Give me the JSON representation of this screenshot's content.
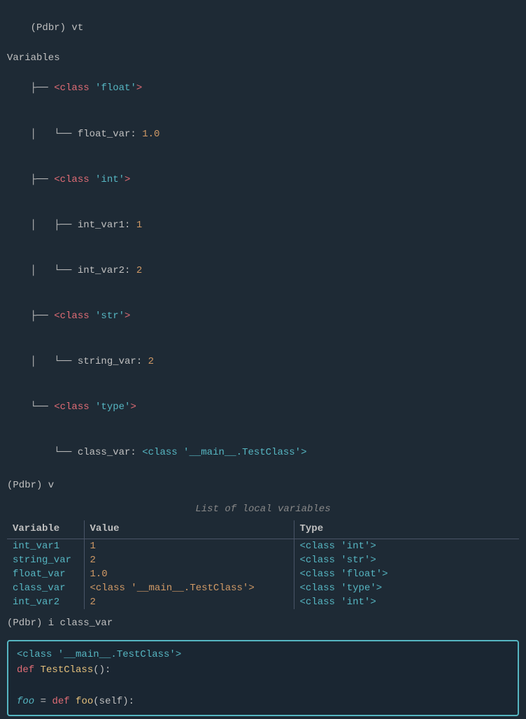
{
  "terminal": {
    "lines": [
      {
        "id": "cmd1",
        "text": "(Pdbr) vt"
      },
      {
        "id": "variables_header",
        "text": "Variables"
      },
      {
        "id": "class_float_line",
        "parts": [
          {
            "text": "├── ",
            "color": "tree"
          },
          {
            "text": "<class ",
            "color": "keyword-red"
          },
          {
            "text": "'float'",
            "color": "teal"
          },
          {
            "text": ">",
            "color": "keyword-red"
          }
        ]
      },
      {
        "id": "float_var_line",
        "parts": [
          {
            "text": "│   └── float_var: ",
            "color": "tree"
          },
          {
            "text": "1.0",
            "color": "orange"
          }
        ]
      },
      {
        "id": "class_int_line",
        "parts": [
          {
            "text": "├── ",
            "color": "tree"
          },
          {
            "text": "<class ",
            "color": "keyword-red"
          },
          {
            "text": "'int'",
            "color": "teal"
          },
          {
            "text": ">",
            "color": "keyword-red"
          }
        ]
      },
      {
        "id": "int_var1_line",
        "parts": [
          {
            "text": "│   ├── int_var1: ",
            "color": "tree"
          },
          {
            "text": "1",
            "color": "orange"
          }
        ]
      },
      {
        "id": "int_var2_line",
        "parts": [
          {
            "text": "│   └── int_var2: ",
            "color": "tree"
          },
          {
            "text": "2",
            "color": "orange"
          }
        ]
      },
      {
        "id": "class_str_line",
        "parts": [
          {
            "text": "├── ",
            "color": "tree"
          },
          {
            "text": "<class ",
            "color": "keyword-red"
          },
          {
            "text": "'str'",
            "color": "teal"
          },
          {
            "text": ">",
            "color": "keyword-red"
          }
        ]
      },
      {
        "id": "string_var_line",
        "parts": [
          {
            "text": "│   └── string_var: ",
            "color": "tree"
          },
          {
            "text": "2",
            "color": "orange"
          }
        ]
      },
      {
        "id": "class_type_line",
        "parts": [
          {
            "text": "└── ",
            "color": "tree"
          },
          {
            "text": "<class ",
            "color": "keyword-red"
          },
          {
            "text": "'type'",
            "color": "teal"
          },
          {
            "text": ">",
            "color": "keyword-red"
          }
        ]
      },
      {
        "id": "class_var_line",
        "parts": [
          {
            "text": "    └── class_var: ",
            "color": "tree"
          },
          {
            "text": "<class '__main__.TestClass'>",
            "color": "teal"
          }
        ]
      }
    ],
    "cmd2": "(Pdbr) v",
    "table_title": "List of local variables",
    "table_headers": [
      "Variable",
      "Value",
      "Type"
    ],
    "table_rows": [
      {
        "variable": "int_var1",
        "value": "1",
        "type": "<class 'int'>"
      },
      {
        "variable": "string_var",
        "value": "2",
        "type": "<class 'str'>"
      },
      {
        "variable": "float_var",
        "value": "1.0",
        "type": "<class 'float'>"
      },
      {
        "variable": "class_var",
        "value": "<class '__main__.TestClass'>",
        "type": "<class 'type'>"
      },
      {
        "variable": "int_var2",
        "value": "2",
        "type": "<class 'int'>"
      }
    ],
    "cmd3": "(Pdbr) i class_var",
    "inspect_lines": [
      {
        "text": "  <class '__main__.TestClass'>",
        "color": "teal"
      },
      {
        "text": "def TestClass():",
        "parts": [
          {
            "text": "def ",
            "color": "red"
          },
          {
            "text": "TestClass",
            "color": "yellow"
          },
          {
            "text": "():",
            "color": "normal"
          }
        ]
      },
      {
        "text": ""
      },
      {
        "text": "foo = def foo(self):",
        "parts": [
          {
            "text": "foo",
            "color": "italic-teal"
          },
          {
            "text": " = def ",
            "color": "normal"
          },
          {
            "text": "foo",
            "color": "yellow"
          },
          {
            "text": "(self):",
            "color": "normal"
          }
        ]
      }
    ]
  }
}
